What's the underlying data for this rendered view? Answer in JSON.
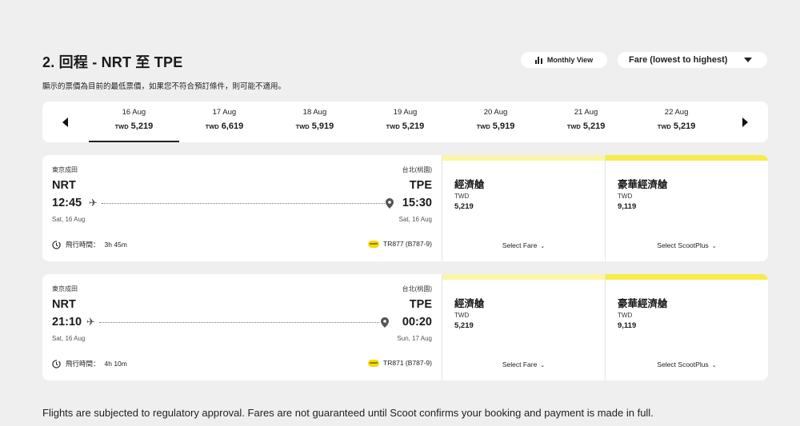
{
  "header": {
    "title": "2. 回程 - NRT 至 TPE",
    "subtitle": "顯示的票價為目前的最低票價，如果您不符合預訂條件，則可能不適用。"
  },
  "controls": {
    "monthly_view": "Monthly View",
    "sort": "Fare (lowest to highest)"
  },
  "dates": [
    {
      "label": "16 Aug",
      "currency": "TWD",
      "price": "5,219",
      "active": true
    },
    {
      "label": "17 Aug",
      "currency": "TWD",
      "price": "6,619"
    },
    {
      "label": "18 Aug",
      "currency": "TWD",
      "price": "5,919"
    },
    {
      "label": "19 Aug",
      "currency": "TWD",
      "price": "5,219"
    },
    {
      "label": "20 Aug",
      "currency": "TWD",
      "price": "5,919"
    },
    {
      "label": "21 Aug",
      "currency": "TWD",
      "price": "5,219"
    },
    {
      "label": "22 Aug",
      "currency": "TWD",
      "price": "5,219"
    }
  ],
  "flights": [
    {
      "from_city": "東京成田",
      "from_code": "NRT",
      "dep_time": "12:45",
      "dep_date": "Sat, 16 Aug",
      "to_city": "台北(桃園)",
      "to_code": "TPE",
      "arr_time": "15:30",
      "arr_date": "Sat, 16 Aug",
      "duration_label": "飛行時間：",
      "duration": "3h 45m",
      "airline_logo_text": "scoot",
      "flight_no": "TR877 (B787-9)",
      "fares": [
        {
          "name": "經濟艙",
          "currency": "TWD",
          "price": "5,219",
          "select": "Select Fare"
        },
        {
          "name": "豪華經濟艙",
          "currency": "TWD",
          "price": "9,119",
          "select": "Select ScootPlus"
        }
      ]
    },
    {
      "from_city": "東京成田",
      "from_code": "NRT",
      "dep_time": "21:10",
      "dep_date": "Sat, 16 Aug",
      "to_city": "台北(桃園)",
      "to_code": "TPE",
      "arr_time": "00:20",
      "arr_date": "Sun, 17 Aug",
      "duration_label": "飛行時間：",
      "duration": "4h 10m",
      "airline_logo_text": "scoot",
      "flight_no": "TR871 (B787-9)",
      "fares": [
        {
          "name": "經濟艙",
          "currency": "TWD",
          "price": "5,219",
          "select": "Select Fare"
        },
        {
          "name": "豪華經濟艙",
          "currency": "TWD",
          "price": "9,119",
          "select": "Select ScootPlus"
        }
      ]
    }
  ],
  "footer": "Flights are subjected to regulatory approval. Fares are not guaranteed until Scoot confirms your booking and payment is made in full.",
  "colors": {
    "background": "#efefef",
    "accent_yellow": "#f7ec4a",
    "light_yellow": "#fbf5a8"
  },
  "icons": [
    "bar-chart-icon",
    "caret-down-icon",
    "arrow-left-icon",
    "arrow-right-icon",
    "plane-icon",
    "location-pin-icon",
    "clock-icon",
    "scoot-logo",
    "chevron-down-icon"
  ]
}
